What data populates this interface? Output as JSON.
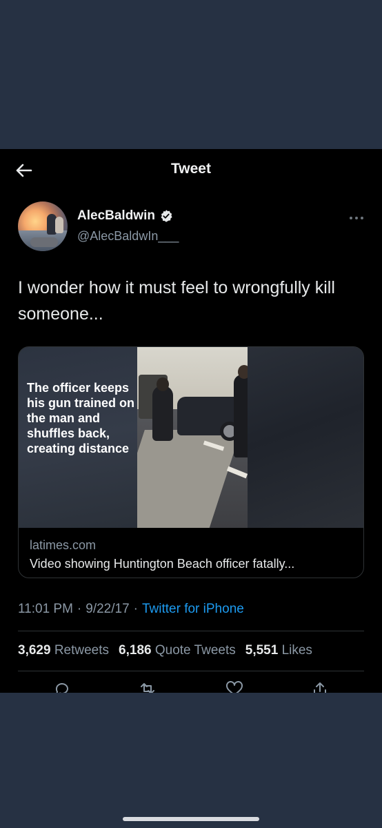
{
  "topbar": {
    "title": "Tweet"
  },
  "author": {
    "display_name": "AlecBaldwin",
    "handle": "@AlecBaldwIn___",
    "verified": true
  },
  "tweet": {
    "text": "I wonder how it must feel to wrongfully kill someone..."
  },
  "card": {
    "overlay_text": "The officer keeps his gun trained on the man and shuffles back, creating distance",
    "domain": "latimes.com",
    "title": "Video showing Huntington Beach officer fatally..."
  },
  "meta": {
    "time": "11:01 PM",
    "separator": "·",
    "date": "9/22/17",
    "source": "Twitter for iPhone"
  },
  "stats": {
    "retweets_count": "3,629",
    "retweets_label": "Retweets",
    "quote_count": "6,186",
    "quote_label": "Quote Tweets",
    "likes_count": "5,551",
    "likes_label": "Likes"
  },
  "icons": [
    "back-arrow-icon",
    "verified-badge-icon",
    "more-options-icon",
    "reply-icon",
    "retweet-icon",
    "like-icon",
    "share-icon"
  ],
  "colors": {
    "background": "#000000",
    "outer_background": "#263143",
    "link": "#1d9bf0",
    "secondary_text": "#8b98a5",
    "divider": "#2f3336"
  }
}
